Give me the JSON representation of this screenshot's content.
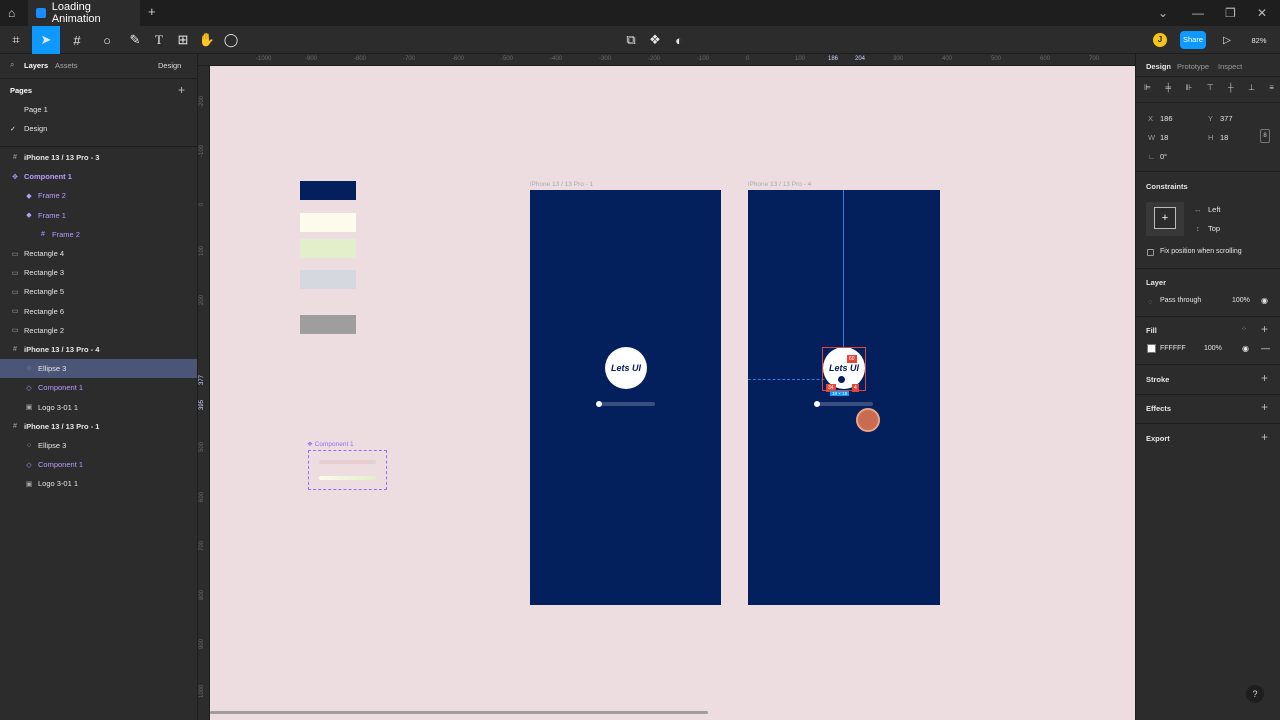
{
  "window": {
    "tab_title": "Loading Animation",
    "add_tab": "+",
    "controls": [
      "⌄",
      "—",
      "❐",
      "✕"
    ]
  },
  "toolbar": {
    "share_label": "Share",
    "zoom": "82%",
    "user_initial": "J"
  },
  "left_panel": {
    "tabs": {
      "layers": "Layers",
      "assets": "Assets",
      "page_select": "Design"
    },
    "pages_title": "Pages",
    "pages": [
      "Page 1",
      "Design"
    ],
    "layers": [
      {
        "label": "iPhone 13 / 13 Pro - 3",
        "icon": "#",
        "level": 0,
        "purple": false,
        "bold": true
      },
      {
        "label": "Component 1",
        "icon": "✥",
        "level": 0,
        "purple": true,
        "bold": true
      },
      {
        "label": "Frame 2",
        "icon": "◆",
        "level": 1,
        "purple": true,
        "bold": false
      },
      {
        "label": "Frame 1",
        "icon": "◆",
        "level": 1,
        "purple": true,
        "bold": false
      },
      {
        "label": "Frame 2",
        "icon": "#",
        "level": 2,
        "purple": true,
        "bold": false
      },
      {
        "label": "Rectangle 4",
        "icon": "▭",
        "level": 0,
        "purple": false,
        "bold": false
      },
      {
        "label": "Rectangle 3",
        "icon": "▭",
        "level": 0,
        "purple": false,
        "bold": false
      },
      {
        "label": "Rectangle 5",
        "icon": "▭",
        "level": 0,
        "purple": false,
        "bold": false
      },
      {
        "label": "Rectangle 6",
        "icon": "▭",
        "level": 0,
        "purple": false,
        "bold": false
      },
      {
        "label": "Rectangle 2",
        "icon": "▭",
        "level": 0,
        "purple": false,
        "bold": false
      },
      {
        "label": "iPhone 13 / 13 Pro - 4",
        "icon": "#",
        "level": 0,
        "purple": false,
        "bold": true
      },
      {
        "label": "Ellipse 3",
        "icon": "○",
        "level": 1,
        "purple": false,
        "bold": false,
        "selected": true
      },
      {
        "label": "Component 1",
        "icon": "◇",
        "level": 1,
        "purple": true,
        "bold": false
      },
      {
        "label": "Logo 3-01 1",
        "icon": "▣",
        "level": 1,
        "purple": false,
        "bold": false
      },
      {
        "label": "iPhone 13 / 13 Pro - 1",
        "icon": "#",
        "level": 0,
        "purple": false,
        "bold": true
      },
      {
        "label": "Ellipse 3",
        "icon": "○",
        "level": 1,
        "purple": false,
        "bold": false
      },
      {
        "label": "Component 1",
        "icon": "◇",
        "level": 1,
        "purple": true,
        "bold": false
      },
      {
        "label": "Logo 3-01 1",
        "icon": "▣",
        "level": 1,
        "purple": false,
        "bold": false
      }
    ]
  },
  "ruler": {
    "top": [
      "-1000",
      "-900",
      "-800",
      "-700",
      "-600",
      "-500",
      "-400",
      "-300",
      "-200",
      "-100",
      "0",
      "100",
      "186",
      "204",
      "300",
      "400",
      "500",
      "600",
      "700"
    ],
    "left": [
      "-200",
      "-100",
      "0",
      "100",
      "200",
      "377",
      "395",
      "500",
      "600",
      "700",
      "800",
      "900",
      "1000"
    ]
  },
  "canvas": {
    "background": "#eddde1",
    "frame_color": "#04205c",
    "frame1_label": "iPhone 13 / 13 Pro - 1",
    "frame4_label": "iPhone 13 / 13 Pro - 4",
    "component_label": "Component 1",
    "logo_text": "Lets UI",
    "swatch_colors": [
      "#04205c",
      "#fdfbeb",
      "#e3eecb",
      "#d6d8e0",
      "#9e9e9e"
    ],
    "measurements": [
      "60",
      "34",
      "4",
      "18 × 18"
    ]
  },
  "right_panel": {
    "tabs": [
      "Design",
      "Prototype",
      "Inspect"
    ],
    "x_label": "X",
    "x_value": "186",
    "y_label": "Y",
    "y_value": "377",
    "w_label": "W",
    "w_value": "18",
    "h_label": "H",
    "h_value": "18",
    "rotation": "0°",
    "constraints_title": "Constraints",
    "constraint_h": "Left",
    "constraint_v": "Top",
    "fix_position": "Fix position when scrolling",
    "layer_title": "Layer",
    "blend_mode": "Pass through",
    "layer_opacity": "100%",
    "fill_title": "Fill",
    "fill_hex": "FFFFFF",
    "fill_opacity": "100%",
    "stroke_title": "Stroke",
    "effects_title": "Effects",
    "export_title": "Export"
  },
  "help": "?"
}
